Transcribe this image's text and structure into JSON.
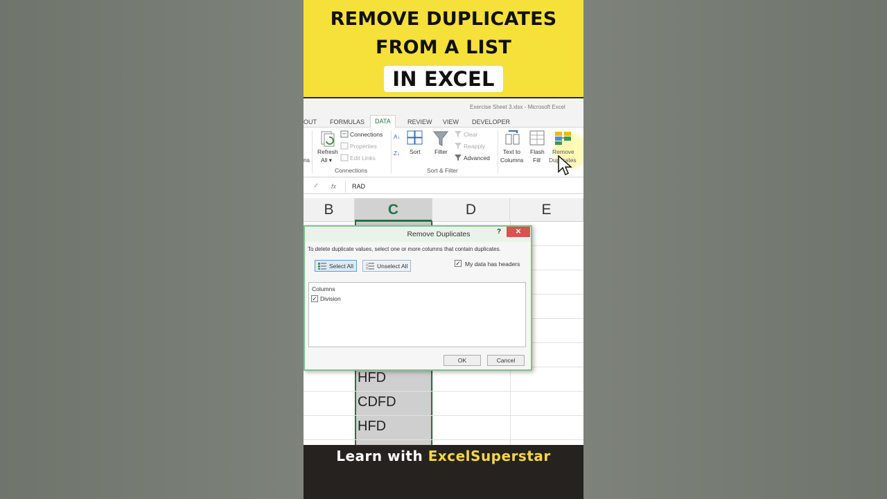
{
  "banner": {
    "line1": "REMOVE DUPLICATES",
    "line2": "FROM A LIST",
    "line3": "IN EXCEL"
  },
  "excel": {
    "window_title": "Exercise Sheet 3.xlsx - Microsoft Excel",
    "tabs": [
      "OUT",
      "FORMULAS",
      "DATA",
      "REVIEW",
      "VIEW",
      "DEVELOPER"
    ],
    "active_tab": "DATA",
    "ribbon": {
      "partial_left": "ns",
      "refresh_all": [
        "Refresh",
        "All ▾"
      ],
      "connections": "Connections",
      "properties": "Properties",
      "edit_links": "Edit Links",
      "group_connections": "Connections",
      "sort": "Sort",
      "filter": "Filter",
      "clear": "Clear",
      "reapply": "Reapply",
      "advanced": "Advanced",
      "group_sort_filter": "Sort & Filter",
      "text_to_columns": [
        "Text to",
        "Columns"
      ],
      "flash_fill": [
        "Flash",
        "Fill"
      ],
      "remove_duplicates": [
        "Remove",
        "Duplicates"
      ]
    },
    "formula_bar": {
      "fx": "fx",
      "value": "RAD"
    },
    "columns": [
      "B",
      "C",
      "D",
      "E"
    ],
    "selected_column": "C",
    "cells": [
      "HFD",
      "CDFD",
      "HFD"
    ]
  },
  "dialog": {
    "title": "Remove Duplicates",
    "help": "?",
    "close": "✕",
    "instruction": "To delete duplicate values, select one or more columns that contain duplicates.",
    "select_all": "Select All",
    "unselect_all": "Unselect All",
    "headers_checkbox": {
      "label": "My data has headers",
      "checked": true
    },
    "columns_header": "Columns",
    "column_items": [
      {
        "label": "Division",
        "checked": true
      }
    ],
    "ok": "OK",
    "cancel": "Cancel"
  },
  "footer": {
    "prefix": "Learn with ",
    "brand": "ExcelSuperstar"
  },
  "colors": {
    "banner_bg": "#f6e03a",
    "excel_green": "#217346",
    "dialog_border": "#7cc48a",
    "footer_bg": "#262220",
    "brand_yellow": "#f5d742"
  }
}
